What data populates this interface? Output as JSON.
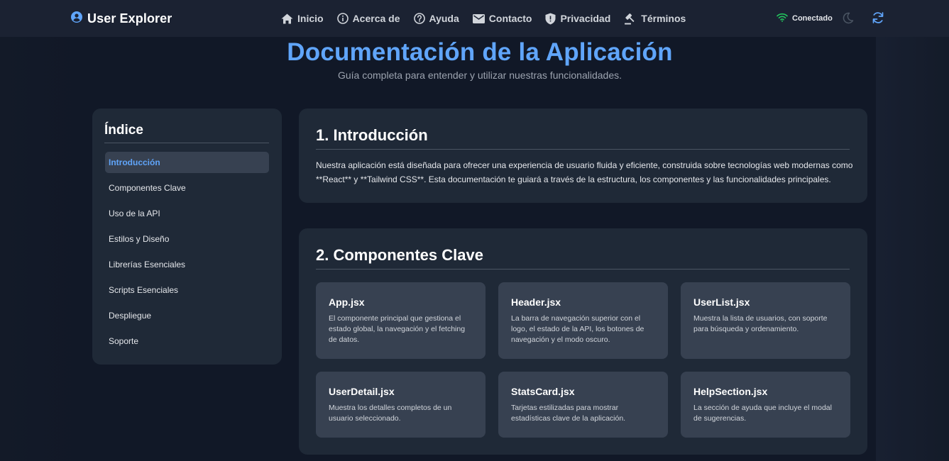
{
  "header": {
    "brand": "User Explorer",
    "nav": [
      {
        "label": "Inicio",
        "icon": "home-icon"
      },
      {
        "label": "Acerca de",
        "icon": "info-icon"
      },
      {
        "label": "Ayuda",
        "icon": "help-icon"
      },
      {
        "label": "Contacto",
        "icon": "mail-icon"
      },
      {
        "label": "Privacidad",
        "icon": "shield-icon"
      },
      {
        "label": "Términos",
        "icon": "gavel-icon"
      }
    ],
    "status": "Conectado",
    "colors": {
      "accent": "#60a5fa",
      "status": "#22c55e"
    }
  },
  "page": {
    "title": "Documentación de la Aplicación",
    "subtitle": "Guía completa para entender y utilizar nuestras funcionalidades."
  },
  "toc": {
    "title": "Índice",
    "items": [
      "Introducción",
      "Componentes Clave",
      "Uso de la API",
      "Estilos y Diseño",
      "Librerías Esenciales",
      "Scripts Esenciales",
      "Despliegue",
      "Soporte"
    ]
  },
  "intro": {
    "heading": "1. Introducción",
    "text": "Nuestra aplicación está diseñada para ofrecer una experiencia de usuario fluida y eficiente, construida sobre tecnologías web modernas como **React** y **Tailwind CSS**. Esta documentación te guiará a través de la estructura, los componentes y las funcionalidades principales."
  },
  "components": {
    "heading": "2. Componentes Clave",
    "items": [
      {
        "name": "App.jsx",
        "desc": "El componente principal que gestiona el estado global, la navegación y el fetching de datos."
      },
      {
        "name": "Header.jsx",
        "desc": "La barra de navegación superior con el logo, el estado de la API, los botones de navegación y el modo oscuro."
      },
      {
        "name": "UserList.jsx",
        "desc": "Muestra la lista de usuarios, con soporte para búsqueda y ordenamiento."
      },
      {
        "name": "UserDetail.jsx",
        "desc": "Muestra los detalles completos de un usuario seleccionado."
      },
      {
        "name": "StatsCard.jsx",
        "desc": "Tarjetas estilizadas para mostrar estadísticas clave de la aplicación."
      },
      {
        "name": "HelpSection.jsx",
        "desc": "La sección de ayuda que incluye el modal de sugerencias."
      }
    ]
  }
}
